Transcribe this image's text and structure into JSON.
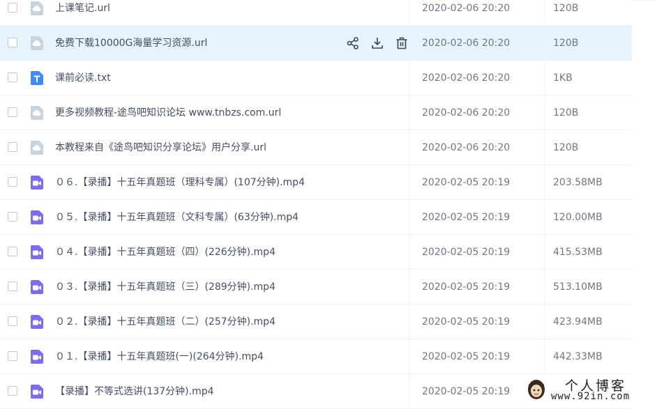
{
  "colors": {
    "accent": "#06a7ff",
    "hover_row": "#e5f3fd",
    "url_icon": "#c8d3e0",
    "txt_icon": "#3c8cff",
    "video_icon": "#7b6cf6"
  },
  "files": [
    {
      "name": "上课笔记.url",
      "date": "2020-02-06 20:20",
      "size": "120B",
      "icon": "url-file-icon",
      "hover": false
    },
    {
      "name": "免费下载10000G海量学习资源.url",
      "date": "2020-02-06 20:20",
      "size": "120B",
      "icon": "url-file-icon",
      "hover": true
    },
    {
      "name": "课前必读.txt",
      "date": "2020-02-06 20:20",
      "size": "1KB",
      "icon": "txt-file-icon",
      "hover": false
    },
    {
      "name": "更多视频教程-途鸟吧知识论坛 www.tnbzs.com.url",
      "date": "2020-02-06 20:20",
      "size": "120B",
      "icon": "url-file-icon",
      "hover": false
    },
    {
      "name": "本教程来自《途鸟吧知识分享论坛》用户分享.url",
      "date": "2020-02-06 20:20",
      "size": "120B",
      "icon": "url-file-icon",
      "hover": false
    },
    {
      "name": "０６.【录播】十五年真题班（理科专属）(107分钟).mp4",
      "date": "2020-02-05 20:19",
      "size": "203.58MB",
      "icon": "video-file-icon",
      "hover": false
    },
    {
      "name": "０５.【录播】十五年真题班（文科专属）(63分钟).mp4",
      "date": "2020-02-05 20:19",
      "size": "120.00MB",
      "icon": "video-file-icon",
      "hover": false
    },
    {
      "name": "０４.【录播】十五年真题班（四）(226分钟).mp4",
      "date": "2020-02-05 20:19",
      "size": "415.53MB",
      "icon": "video-file-icon",
      "hover": false
    },
    {
      "name": "０３.【录播】十五年真题班（三）(289分钟).mp4",
      "date": "2020-02-05 20:19",
      "size": "513.10MB",
      "icon": "video-file-icon",
      "hover": false
    },
    {
      "name": "０２.【录播】十五年真题班（二）(257分钟).mp4",
      "date": "2020-02-05 20:19",
      "size": "423.94MB",
      "icon": "video-file-icon",
      "hover": false
    },
    {
      "name": "０１.【录播】十五年真题班(一)(264分钟).mp4",
      "date": "2020-02-05 20:19",
      "size": "442.33MB",
      "icon": "video-file-icon",
      "hover": false
    },
    {
      "name": "【录播】不等式选讲(137分钟).mp4",
      "date": "2020-02-05 20:19",
      "size": "",
      "icon": "video-file-icon",
      "hover": false
    }
  ],
  "row_actions": {
    "share_icon": "share-icon",
    "download_icon": "download-icon",
    "delete_icon": "trash-icon"
  },
  "watermark": {
    "title": "个人博客",
    "url": "www.92in.com"
  }
}
